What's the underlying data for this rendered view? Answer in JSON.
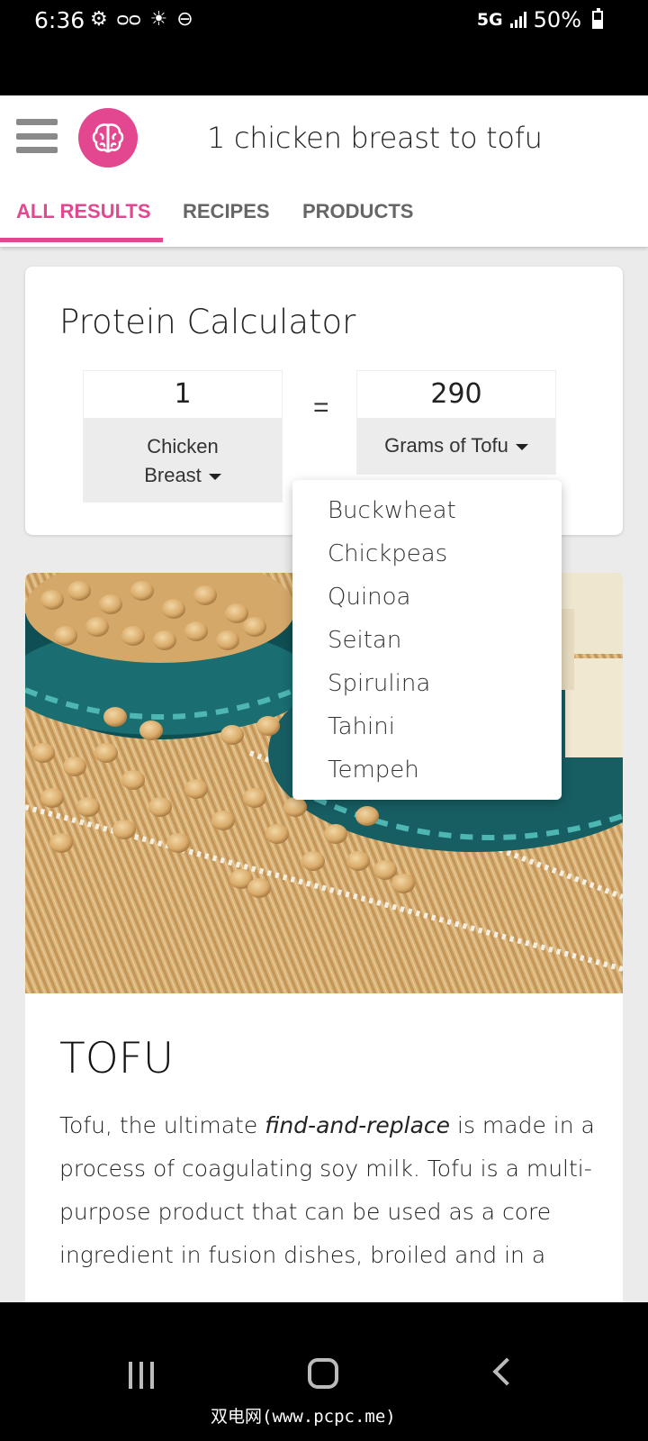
{
  "status_bar": {
    "time": "6:36",
    "network": "5G",
    "battery": "50%"
  },
  "header": {
    "title": "1 chicken breast to tofu",
    "brand_color": "#e3478f"
  },
  "tabs": [
    {
      "label": "ALL RESULTS",
      "active": true
    },
    {
      "label": "RECIPES",
      "active": false
    },
    {
      "label": "PRODUCTS",
      "active": false
    }
  ],
  "calculator": {
    "title": "Protein Calculator",
    "from_value": "1",
    "from_unit_line1": "Chicken",
    "from_unit_line2": "Breast",
    "equals": "=",
    "to_value": "290",
    "to_unit": "Grams of Tofu"
  },
  "dropdown": {
    "options": [
      "Buckwheat",
      "Chickpeas",
      "Quinoa",
      "Seitan",
      "Spirulina",
      "Tahini",
      "Tempeh"
    ]
  },
  "article": {
    "heading": "TOFU",
    "desc_before": "Tofu, the ultimate ",
    "desc_emphasis": "find-and-replace",
    "desc_after": " is made in a process of coagulating soy milk. Tofu is a multi-purpose product that can be used as a core ingredient in fusion dishes, broiled and in a"
  },
  "watermark": "双电网(www.pcpc.me)"
}
